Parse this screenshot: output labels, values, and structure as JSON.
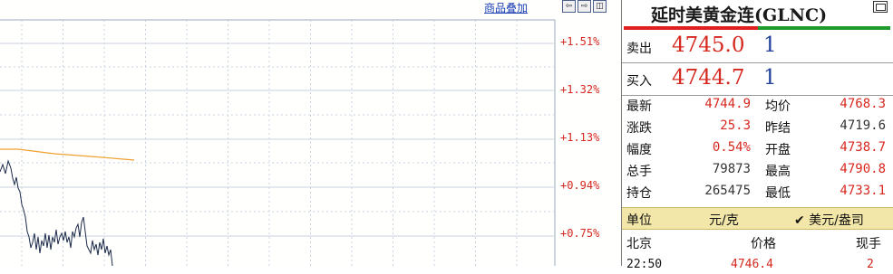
{
  "chart": {
    "overlay_link": "商品叠加",
    "percent_labels": [
      "+1.51%",
      "+1.32%",
      "+1.13%",
      "+0.94%",
      "+0.75%"
    ],
    "colors": {
      "grid": "#c9d3e0",
      "price_line": "#1b2a4a",
      "avg_line": "#f0a030",
      "axis_text": "#d6281f"
    }
  },
  "panel": {
    "title": "延时美黄金连(GLNC)",
    "sell": {
      "label": "卖出",
      "price": "4745.0",
      "volume": "1"
    },
    "buy": {
      "label": "买入",
      "price": "4744.7",
      "volume": "1"
    },
    "stats": [
      {
        "l1": "最新",
        "v1": "4744.9",
        "c1": "red",
        "l2": "均价",
        "v2": "4768.3",
        "c2": "red"
      },
      {
        "l1": "涨跌",
        "v1": "25.3",
        "c1": "red",
        "l2": "昨结",
        "v2": "4719.6",
        "c2": "black"
      },
      {
        "l1": "幅度",
        "v1": "0.54%",
        "c1": "red",
        "l2": "开盘",
        "v2": "4738.7",
        "c2": "red"
      },
      {
        "l1": "总手",
        "v1": "79873",
        "c1": "black",
        "l2": "最高",
        "v2": "4790.8",
        "c2": "red"
      },
      {
        "l1": "持仓",
        "v1": "265475",
        "c1": "black",
        "l2": "最低",
        "v2": "4733.1",
        "c2": "red"
      }
    ],
    "unit": {
      "label": "单位",
      "value": "元/克",
      "alt": "✔ 美元/盎司"
    },
    "ticks_header": {
      "location": "北京",
      "price": "价格",
      "volume": "现手"
    },
    "tick": {
      "time": "22:50",
      "price": "4746.4",
      "volume": "2"
    }
  }
}
